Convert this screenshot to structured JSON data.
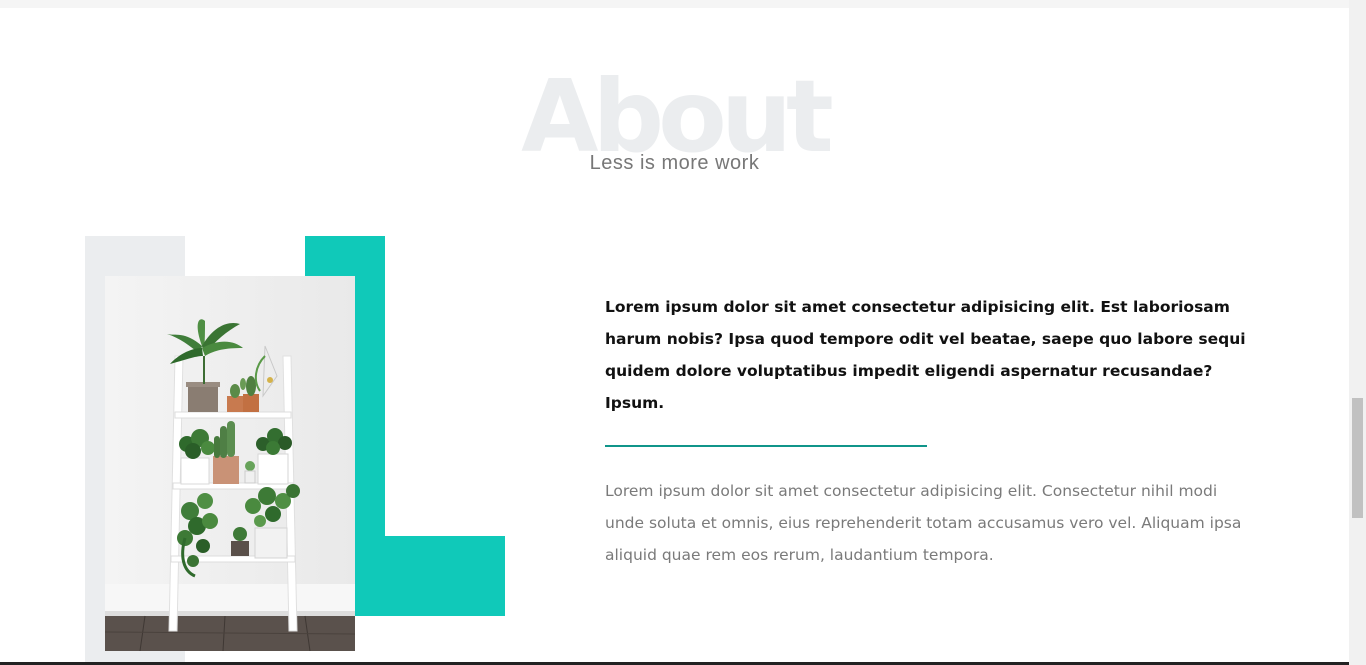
{
  "about": {
    "background_word": "About",
    "subtitle": "Less is more work"
  },
  "content": {
    "lead": "Lorem ipsum dolor sit amet consectetur adipisicing elit. Est laboriosam harum nobis? Ipsa quod tempore odit vel beatae, saepe quo labore sequi quidem dolore voluptatibus impedit eligendi aspernatur recusandae? Ipsum.",
    "body": "Lorem ipsum dolor sit amet consectetur adipisicing elit. Consectetur nihil modi unde soluta et omnis, eius reprehenderit totam accusamus vero vel. Aliquam ipsa aliquid quae rem eos rerum, laudantium tempora."
  },
  "colors": {
    "accent": "#10c9b9",
    "divider": "#10958a",
    "block_grey": "#ebedef"
  },
  "image": {
    "subject": "plants-on-white-ladder-shelf"
  }
}
